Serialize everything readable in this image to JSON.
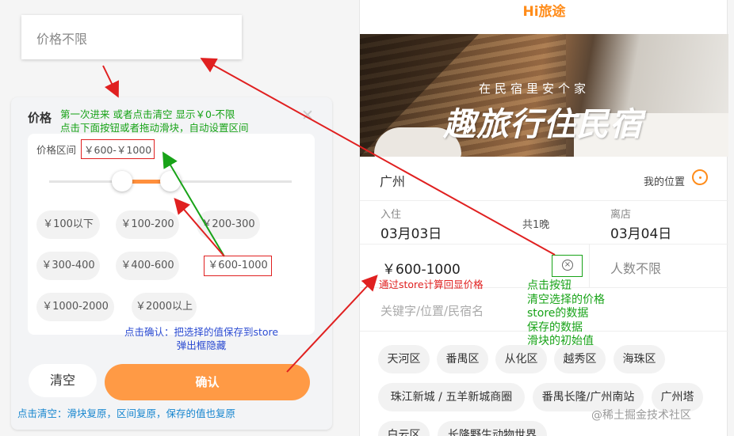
{
  "left": {
    "price_none_label": "价格不限",
    "panel": {
      "title": "价格",
      "close_icon": "close-icon",
      "note_first": "第一次进来 或者点击清空 显示￥0-不限",
      "note_second": "点击下面按钮或者拖动滑块，自动设置区间",
      "range_label": "价格区间",
      "range_value": "￥600-￥1000",
      "chips": [
        "￥100以下",
        "￥100-200",
        "￥200-300",
        "￥300-400",
        "￥400-600",
        "￥600-1000",
        "￥1000-2000",
        "￥2000以上"
      ],
      "selected_chip": "￥600-1000",
      "confirm_note_1": "点击确认：把选择的值保存到store",
      "confirm_note_2": "弹出框隐藏",
      "clear_label": "清空",
      "confirm_label": "确认",
      "clear_note": "点击清空：滑块复原，区间复原，保存的值也复原"
    }
  },
  "right": {
    "app_title": "Hi旅途",
    "banner_subtitle": "在民宿里安个家",
    "banner_title": "趣旅行住民宿",
    "city": "广州",
    "my_location": "我的位置",
    "checkin_label": "入住",
    "checkin_date": "03月03日",
    "nights": "共1晚",
    "checkout_label": "离店",
    "checkout_date": "03月04日",
    "price_selected": "￥600-1000",
    "price_note": "通过store计算回显价格",
    "people": "人数不限",
    "keyword_placeholder": "关键字/位置/民宿名",
    "clear_button_notes": [
      "点击按钮",
      "清空选择的价格",
      "store的数据",
      "保存的数据",
      "滑块的初始值"
    ],
    "tags_row1": [
      "天河区",
      "番禺区",
      "从化区",
      "越秀区",
      "海珠区"
    ],
    "tags_row2": [
      "珠江新城 / 五羊新城商圈",
      "番禺长隆/广州南站",
      "广州塔"
    ],
    "tags_row3": [
      "白云区",
      "长隆野生动物世界"
    ],
    "watermark": "@稀土掘金技术社区"
  },
  "colors": {
    "accent": "#ff8c1a",
    "confirm": "#ff9a45",
    "annotation_red": "#e02020",
    "annotation_green": "#18a318",
    "annotation_blue": "#2a4ad1"
  }
}
